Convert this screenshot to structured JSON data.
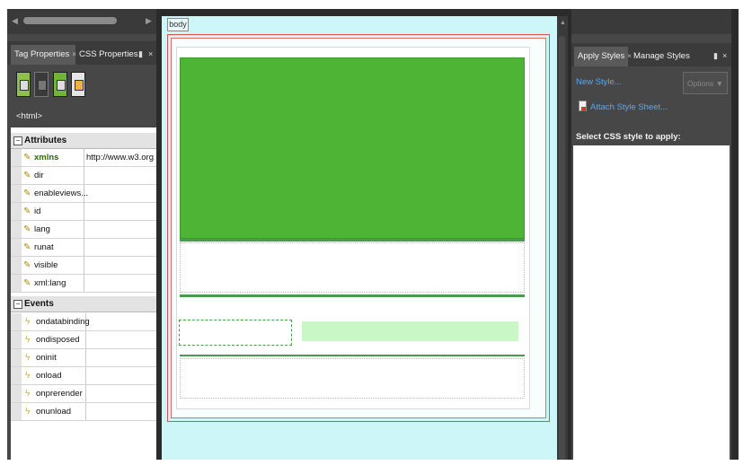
{
  "left_panel": {
    "tabs": [
      {
        "label": "Tag Properties",
        "close": "×"
      },
      {
        "label": "CSS Properties"
      }
    ],
    "pin_icon": "pin-icon",
    "tag_label": "<html>",
    "categories": {
      "attributes": {
        "label": "Attributes",
        "toggle": "−",
        "items": [
          {
            "name": "xmlns",
            "value": "http://www.w3.org..."
          },
          {
            "name": "dir",
            "value": ""
          },
          {
            "name": "enableviews...",
            "value": ""
          },
          {
            "name": "id",
            "value": ""
          },
          {
            "name": "lang",
            "value": ""
          },
          {
            "name": "runat",
            "value": ""
          },
          {
            "name": "visible",
            "value": ""
          },
          {
            "name": "xml:lang",
            "value": ""
          }
        ]
      },
      "events": {
        "label": "Events",
        "toggle": "−",
        "items": [
          {
            "name": "ondatabinding"
          },
          {
            "name": "ondisposed"
          },
          {
            "name": "oninit"
          },
          {
            "name": "onload"
          },
          {
            "name": "onprerender"
          },
          {
            "name": "onunload"
          }
        ]
      }
    }
  },
  "design_view": {
    "body_tag": "body",
    "colors": {
      "header": "#4db436",
      "accent_line": "#4c9a4c",
      "nav_fill": "#c9f7c6",
      "background": "#cdf6f8"
    }
  },
  "right_panel": {
    "tabs": [
      {
        "label": "Apply Styles",
        "close": "×"
      },
      {
        "label": "Manage Styles"
      }
    ],
    "new_style": "New Style...",
    "options": "Options",
    "options_arrow": "▼",
    "attach": "Attach Style Sheet...",
    "select_label": "Select CSS style to apply:"
  }
}
